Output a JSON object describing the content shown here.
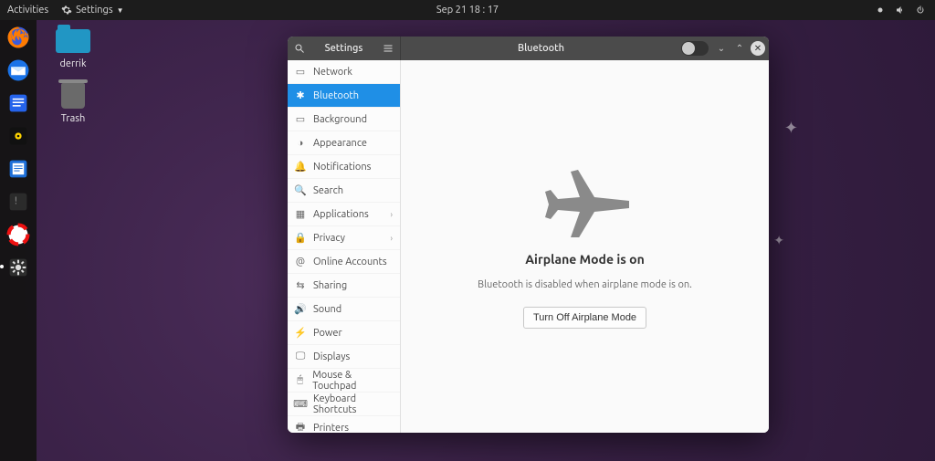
{
  "topbar": {
    "activities": "Activities",
    "app_name": "Settings",
    "datetime": "Sep 21  18 : 17"
  },
  "desktop": {
    "folder_label": "derrik",
    "trash_label": "Trash"
  },
  "window": {
    "sidebar_title": "Settings",
    "panel_title": "Bluetooth"
  },
  "sidebar": {
    "items": [
      {
        "label": "Network",
        "icon": "▭",
        "has_sub": false
      },
      {
        "label": "Bluetooth",
        "icon": "✱",
        "has_sub": false
      },
      {
        "label": "Background",
        "icon": "▭",
        "has_sub": false
      },
      {
        "label": "Appearance",
        "icon": "◑",
        "has_sub": false
      },
      {
        "label": "Notifications",
        "icon": "🔔",
        "has_sub": false
      },
      {
        "label": "Search",
        "icon": "🔍",
        "has_sub": false
      },
      {
        "label": "Applications",
        "icon": "▦",
        "has_sub": true
      },
      {
        "label": "Privacy",
        "icon": "🔒",
        "has_sub": true
      },
      {
        "label": "Online Accounts",
        "icon": "@",
        "has_sub": false
      },
      {
        "label": "Sharing",
        "icon": "⇆",
        "has_sub": false
      },
      {
        "label": "Sound",
        "icon": "🔊",
        "has_sub": false
      },
      {
        "label": "Power",
        "icon": "⚡",
        "has_sub": false
      },
      {
        "label": "Displays",
        "icon": "🖵",
        "has_sub": false
      },
      {
        "label": "Mouse & Touchpad",
        "icon": "🖱",
        "has_sub": false
      },
      {
        "label": "Keyboard Shortcuts",
        "icon": "⌨",
        "has_sub": false
      },
      {
        "label": "Printers",
        "icon": "🖶",
        "has_sub": false
      }
    ],
    "selected_index": 1
  },
  "content": {
    "heading": "Airplane Mode is on",
    "subtext": "Bluetooth is disabled when airplane mode is on.",
    "button": "Turn Off Airplane Mode"
  }
}
